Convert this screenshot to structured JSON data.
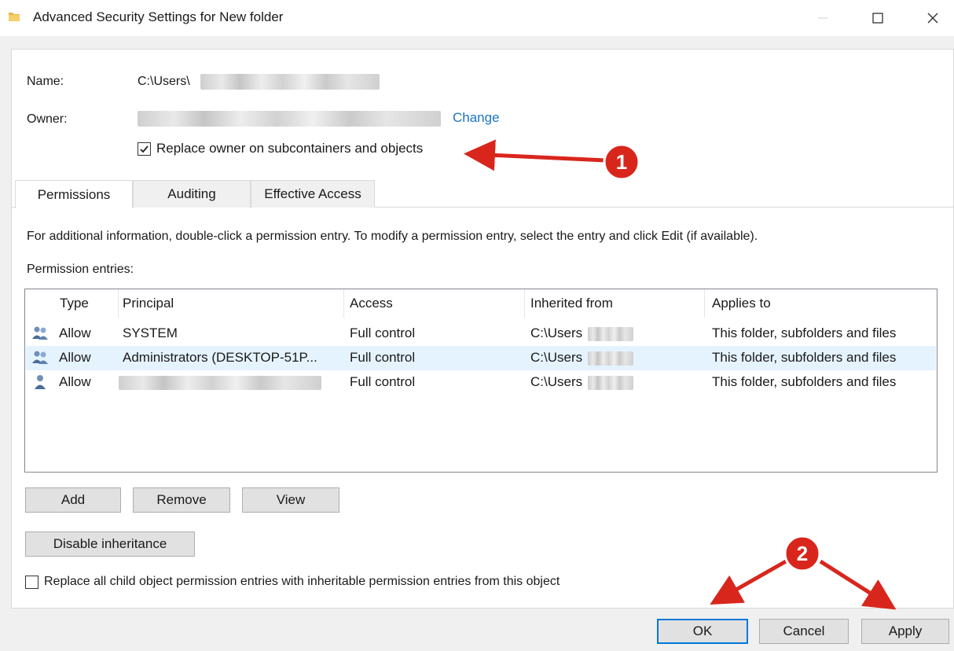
{
  "window": {
    "title": "Advanced Security Settings for New folder",
    "icon": "folder-icon"
  },
  "name_row": {
    "label": "Name:",
    "value_prefix": "C:\\Users\\"
  },
  "owner_row": {
    "label": "Owner:",
    "change_link": "Change"
  },
  "replace_owner": {
    "label": "Replace owner on subcontainers and objects",
    "checked": true
  },
  "tabs": [
    {
      "label": "Permissions",
      "active": true
    },
    {
      "label": "Auditing",
      "active": false
    },
    {
      "label": "Effective Access",
      "active": false
    }
  ],
  "info_text": "For additional information, double-click a permission entry. To modify a permission entry, select the entry and click Edit (if available).",
  "entries_label": "Permission entries:",
  "table": {
    "columns": [
      "Type",
      "Principal",
      "Access",
      "Inherited from",
      "Applies to"
    ],
    "rows": [
      {
        "icon": "group-users-icon",
        "type": "Allow",
        "principal": "SYSTEM",
        "access": "Full control",
        "inherited": "C:\\Users",
        "applies": "This folder, subfolders and files"
      },
      {
        "icon": "group-users-icon",
        "type": "Allow",
        "principal": "Administrators (DESKTOP-51P...",
        "access": "Full control",
        "inherited": "C:\\Users",
        "applies": "This folder, subfolders and files"
      },
      {
        "icon": "user-icon",
        "type": "Allow",
        "principal": "",
        "access": "Full control",
        "inherited": "C:\\Users",
        "applies": "This folder, subfolders and files"
      }
    ]
  },
  "buttons": {
    "add": "Add",
    "remove": "Remove",
    "view": "View",
    "disable_inheritance": "Disable inheritance",
    "ok": "OK",
    "cancel": "Cancel",
    "apply": "Apply"
  },
  "replace_child": {
    "label": "Replace all child object permission entries with inheritable permission entries from this object",
    "checked": false
  },
  "annotations": {
    "marker1": "1",
    "marker2": "2",
    "color": "#d9261c"
  },
  "colors": {
    "link": "#1a74c4",
    "accent": "#0078d7",
    "selection": "#e5f3ff"
  }
}
